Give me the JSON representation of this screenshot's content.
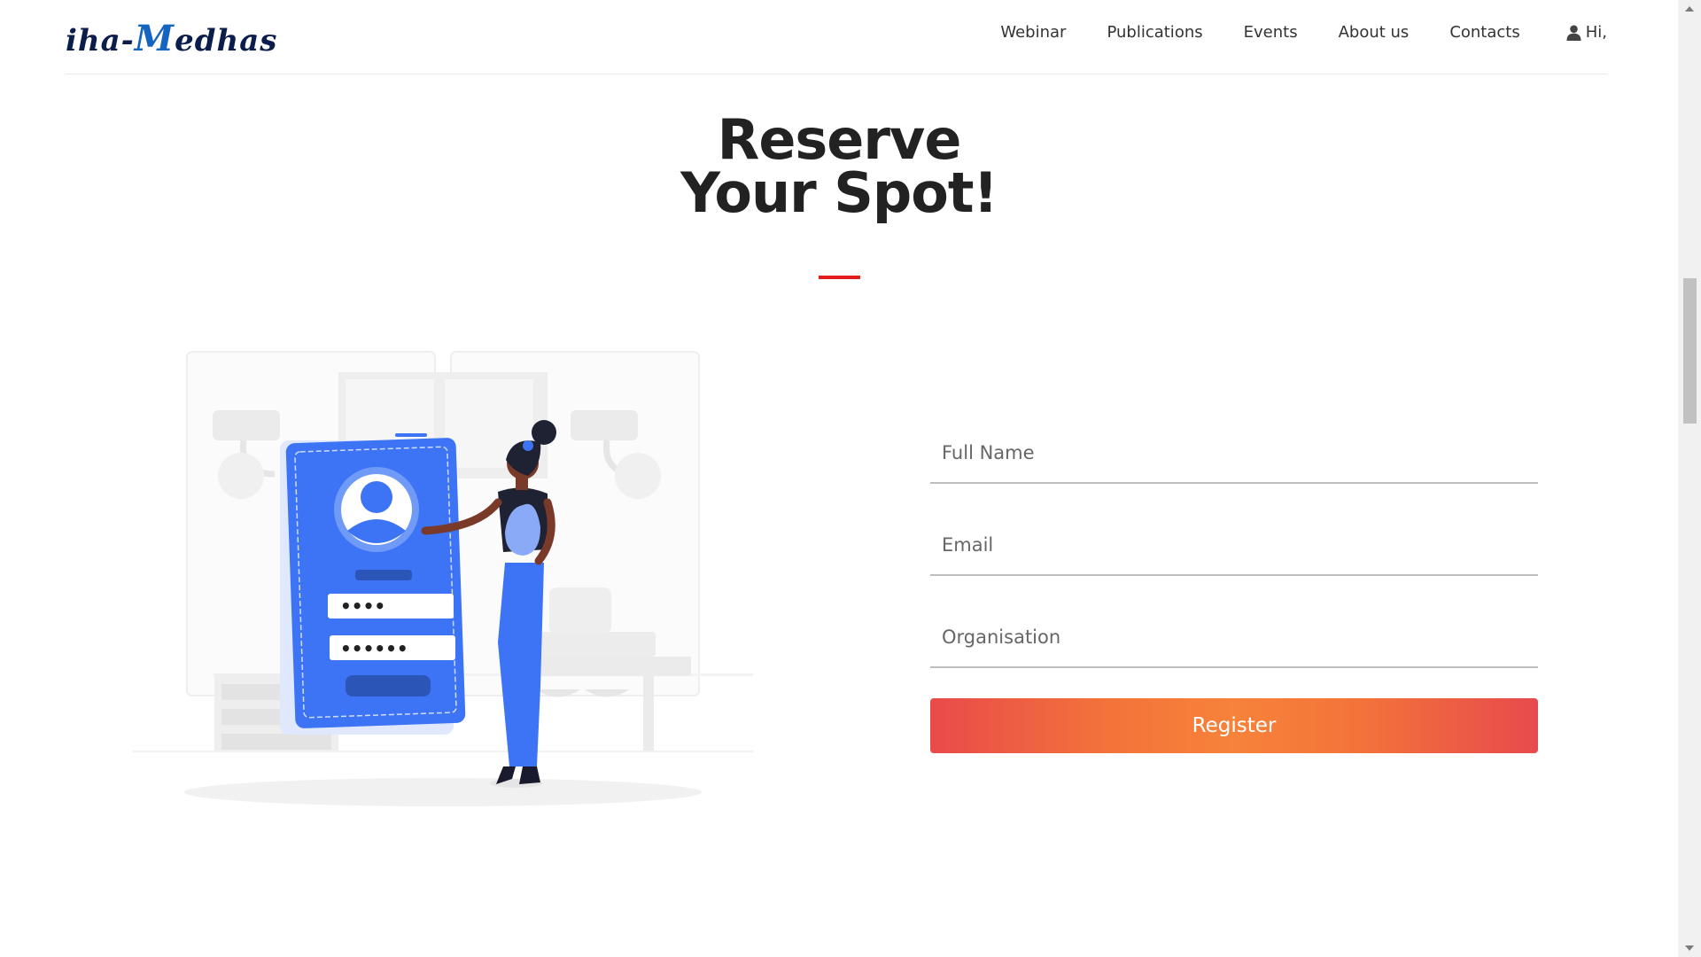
{
  "brand": {
    "logo_text_left": "iha-",
    "logo_text_accent": "M",
    "logo_text_right": "edhas"
  },
  "nav": {
    "items": [
      {
        "label": "Webinar"
      },
      {
        "label": "Publications"
      },
      {
        "label": "Events"
      },
      {
        "label": "About us"
      },
      {
        "label": "Contacts"
      }
    ],
    "user_greeting": "Hi,",
    "user_icon": "user-icon"
  },
  "main": {
    "title_line1": "Reserve",
    "title_line2": "Your Spot!",
    "accent_color": "#e41b1b"
  },
  "illustration": {
    "phone_password_1": "••••",
    "phone_password_2": "••••••",
    "primary_color": "#3d74f5"
  },
  "form": {
    "full_name_placeholder": "Full Name",
    "email_placeholder": "Email",
    "organisation_placeholder": "Organisation",
    "full_name_value": "",
    "email_value": "",
    "organisation_value": "",
    "register_label": "Register",
    "button_gradient_start": "#e94a4a",
    "button_gradient_mid": "#f7823a"
  }
}
